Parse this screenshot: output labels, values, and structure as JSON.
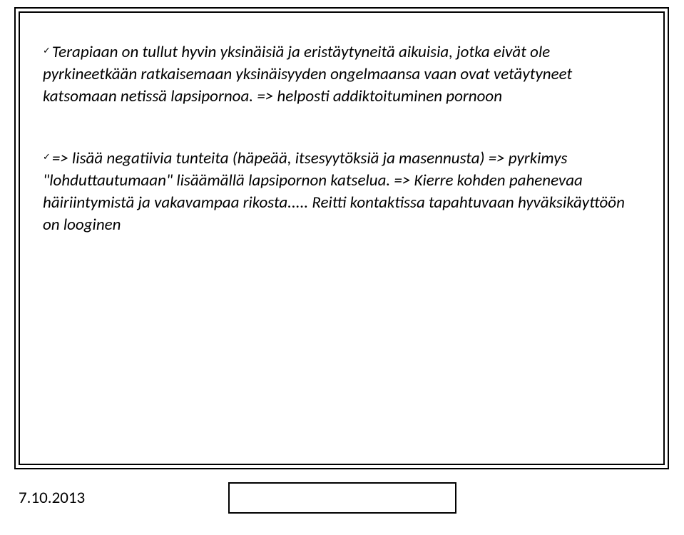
{
  "paragraphs": {
    "p1": "Terapiaan on tullut hyvin yksinäisiä ja eristäytyneitä aikuisia, jotka eivät ole pyrkineetkään ratkaisemaan yksinäisyyden ongelmaansa vaan ovat vetäytyneet  katsomaan netissä lapsipornoa. => helposti addiktoituminen pornoon",
    "p2": "=>  lisää negatiivia tunteita (häpeää, itsesyytöksiä ja masennusta) => pyrkimys \"lohduttautumaan\" lisäämällä lapsipornon katselua.  => Kierre kohden pahenevaa häiriintymistä ja vakavampaa rikosta.....  Reitti kontaktissa tapahtuvaan hyväksikäyttöön on looginen"
  },
  "footer": {
    "date": "7.10.2013"
  },
  "bullet_glyph": "✓"
}
